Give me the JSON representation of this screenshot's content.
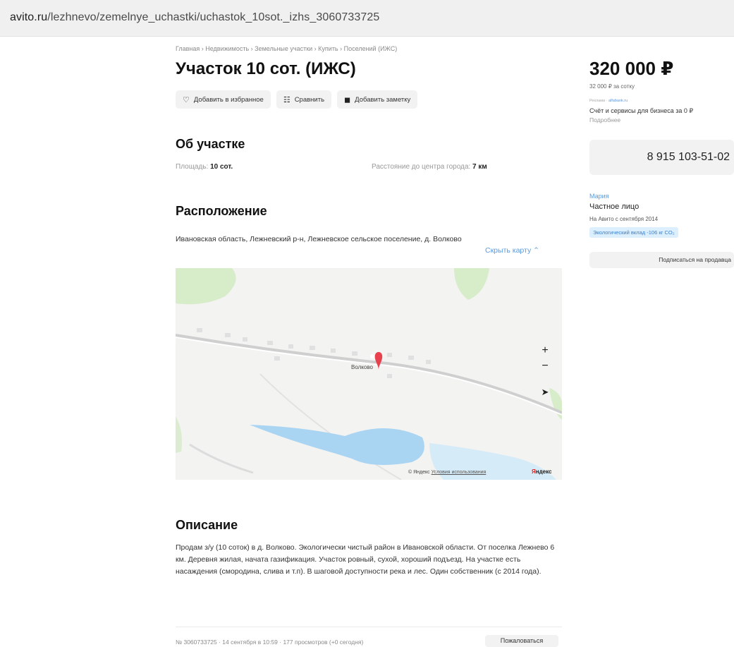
{
  "browser": {
    "url_domain": "avito.ru",
    "url_path": "/lezhnevo/zemelnye_uchastki/uchastok_10sot._izhs_3060733725"
  },
  "breadcrumbs": "Главная › Недвижимость › Земельные участки › Купить › Поселений (ИЖС)",
  "title": "Участок 10 сот. (ИЖС)",
  "actions": {
    "favorite": "Добавить в избранное",
    "compare": "Сравнить",
    "note": "Добавить заметку"
  },
  "about": {
    "heading": "Об участке",
    "area_label": "Площадь:",
    "area_value": "10 сот.",
    "distance_label": "Расстояние до центра города:",
    "distance_value": "7 км"
  },
  "location": {
    "heading": "Расположение",
    "address": "Ивановская область, Лежневский р-н, Лежневское сельское поселение, д. Волково",
    "hide_map": "Скрыть карту ⌃",
    "village_label": "Волково",
    "credit_prefix": "© Яндекс",
    "credit_terms": "Условия использования",
    "logo_first": "Я",
    "logo_rest": "ндекс"
  },
  "description": {
    "heading": "Описание",
    "text": "Продам з/у (10 соток) в д. Волково. Экологически чистый район в Ивановской области. От поселка Лежнево 6 км. Деревня жилая, начата газификация. Участок ровный, сухой, хороший подъезд. На участке есть насаждения (смородина, слива и т.п). В шаговой доступности река и лес. Один собственник (с 2014 года)."
  },
  "footer": {
    "meta": "№ 3060733725 · 14 сентября в 10:59 · 177 просмотров (+0 сегодня)",
    "report": "Пожаловаться"
  },
  "sidebar": {
    "price": "320 000 ₽",
    "price_per": "32 000 ₽ за сотку",
    "ad_label": "Реклама",
    "ad_link": "alfabank.ru",
    "ad_text": "Счёт и сервисы для бизнеса за 0 ₽",
    "ad_more": "Подробнее",
    "phone": "8 915 103-51-02",
    "seller_name": "Мария",
    "seller_type": "Частное лицо",
    "seller_since": "На Авито с сентября 2014",
    "eco_badge": "Экологический вклад -106 кг CO₂",
    "subscribe": "Подписаться на продавца"
  },
  "colors": {
    "accent_link": "#5a9be0",
    "map_water": "#a9d4f2",
    "map_forest": "#d7ecc9",
    "marker": "#e8424f"
  }
}
